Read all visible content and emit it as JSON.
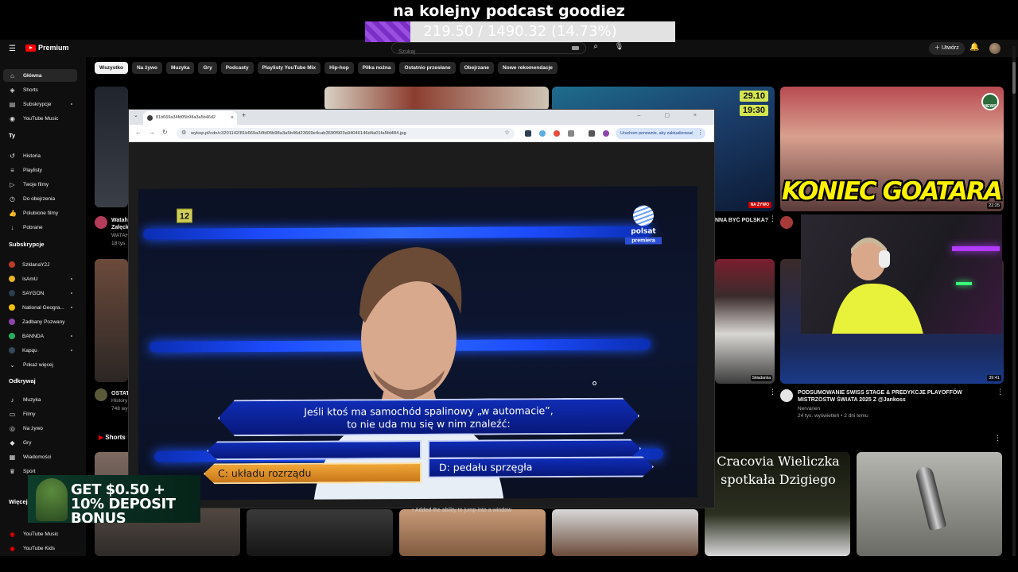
{
  "stream": {
    "title": "na kolejny podcast goodiez",
    "goal_text": "219.50 / 1490.32 (14.73%)",
    "goal_fraction": 0.1473
  },
  "youtube": {
    "logo_text": "Premium",
    "search_placeholder": "Szukaj",
    "create_label": "Utwórz",
    "chips": [
      "Wszystko",
      "Na żywo",
      "Muzyka",
      "Gry",
      "Podcasty",
      "Playlisty YouTube Mix",
      "Hip-hop",
      "Piłka nożna",
      "Ostatnio przesłane",
      "Obejrzane",
      "Nowe rekomendacje"
    ],
    "sidebar": {
      "main": [
        {
          "label": "Główna",
          "icon": "home-icon",
          "glyph": "⌂"
        },
        {
          "label": "Shorts",
          "icon": "shorts-icon",
          "glyph": "◈"
        },
        {
          "label": "Subskrypcje",
          "icon": "subscriptions-icon",
          "glyph": "▤"
        },
        {
          "label": "YouTube Music",
          "icon": "music-icon",
          "glyph": "◉"
        }
      ],
      "you_heading": "Ty",
      "you": [
        {
          "label": "Historia",
          "icon": "history-icon",
          "glyph": "↺"
        },
        {
          "label": "Playlisty",
          "icon": "playlist-icon",
          "glyph": "≡"
        },
        {
          "label": "Twoje filmy",
          "icon": "your-videos-icon",
          "glyph": "▷"
        },
        {
          "label": "Do obejrzenia",
          "icon": "watch-later-icon",
          "glyph": "◷"
        },
        {
          "label": "Polubione filmy",
          "icon": "like-icon",
          "glyph": "👍"
        },
        {
          "label": "Pobrane",
          "icon": "download-icon",
          "glyph": "↓"
        }
      ],
      "subs_heading": "Subskrypcje",
      "subs": [
        {
          "label": "SzklanaY2J",
          "color": "#c0392b"
        },
        {
          "label": "IsAmU",
          "color": "#e6b422"
        },
        {
          "label": "SAYGON",
          "color": "#2c3e50"
        },
        {
          "label": "National Geogra...",
          "color": "#f4c20d"
        },
        {
          "label": "Zadbany Pozwany",
          "color": "#8e44ad"
        },
        {
          "label": "BANNDA",
          "color": "#27ae60"
        },
        {
          "label": "Kapqu",
          "color": "#34495e"
        }
      ],
      "show_more": "Pokaż więcej",
      "explore_heading": "Odkrywaj",
      "explore": [
        {
          "label": "Muzyka",
          "icon": "music-note-icon",
          "glyph": "♪"
        },
        {
          "label": "Filmy",
          "icon": "film-icon",
          "glyph": "▭"
        },
        {
          "label": "Na żywo",
          "icon": "live-icon",
          "glyph": "◎"
        },
        {
          "label": "Gry",
          "icon": "gaming-icon",
          "glyph": "◆"
        },
        {
          "label": "Wiadomości",
          "icon": "news-icon",
          "glyph": "▦"
        },
        {
          "label": "Sport",
          "icon": "trophy-icon",
          "glyph": "♛"
        }
      ],
      "more_heading": "Więcej z",
      "more": [
        {
          "label": "YouTube Music",
          "icon": "yt-music-icon"
        },
        {
          "label": "YouTube Kids",
          "icon": "yt-kids-icon"
        }
      ]
    },
    "videos": {
      "v1": {
        "title": "Watah\nZałęck",
        "channel": "WATAH",
        "meta": "18 tys."
      },
      "v2": {
        "title": "NNA BYĆ POLSKA?",
        "overlay_top": "29.10",
        "overlay_bottom": "19:30",
        "badge": "NA ŻYWO"
      },
      "v3": {
        "title": "KONIEC GOATARA?",
        "corner_badge": "NEWS",
        "duration": "22:25"
      },
      "v4": {
        "title": "OSTAT",
        "meta1": "History",
        "meta2": "748 wy"
      },
      "v5": {
        "title": "PODSUMOWANIE SWISS STAGE & PREDYKCJE PLAYOFFÓW MISTRZOSTW ŚWIATA 2025 Z @Jankoss",
        "channel": "Nervarien",
        "meta": "24 tys. wyświetleń • 2 dni temu",
        "duration": "39:41"
      },
      "v6": {
        "badge": "Składanka"
      },
      "shorts_heading": "Shorts",
      "cracovia_title": "Cracovia Wieliczka spotkała Dzigiego",
      "bottom_caption": "• Added the ability to jump into a window"
    }
  },
  "browser": {
    "tab_title": "81b669a34fd05b98a3a5b46d2",
    "url": "wykop.pl/cdn/c3201142/81b669a34fd05b98a3a5b46d23669e4cab3690f903a94046146d4a01fa5fd484.jpg",
    "update_label": "Uruchom ponownie, aby zaktualizować"
  },
  "tv": {
    "rating": "12",
    "channel_name": "polsat",
    "channel_badge": "premiera",
    "question_line1": "Jeśli ktoś ma samochód spalinowy „w automacie”,",
    "question_line2": "to nie uda mu się w nim znaleźć:",
    "answer_c": "C: układu rozrządu",
    "answer_d": "D: pedału sprzęgła"
  },
  "ad": {
    "text": "GET $0.50 + 10% DEPOSIT BONUS"
  },
  "colors": {
    "accent_red": "#ff0000",
    "twitch_purple": "#9147ff",
    "answer_gold": "#f0a636",
    "tv_blue": "#1d4cff"
  }
}
